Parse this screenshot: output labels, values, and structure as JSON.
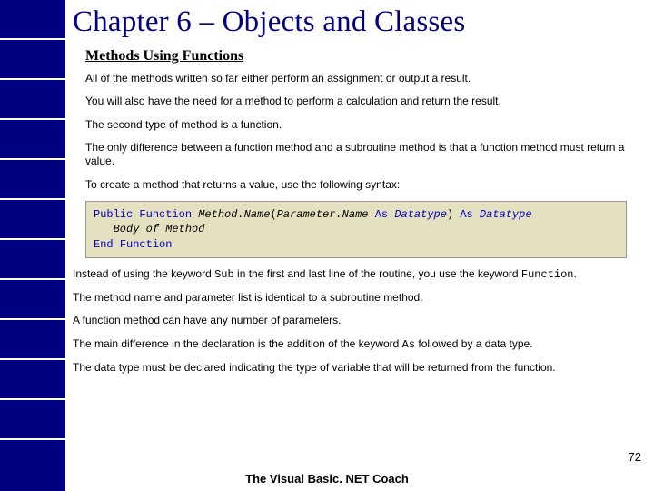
{
  "title": "Chapter 6 – Objects and Classes",
  "subtitle": "Methods Using Functions",
  "paragraphs": {
    "p1": "All of the methods written so far either perform an assignment or output a result.",
    "p2": "You will also have the need for a method to perform a calculation and return the result.",
    "p3": "The second type of method is a function.",
    "p4": "The only difference between a function method and a subroutine method is that a function method must return a value.",
    "p5": "To create a method that returns a value, use the following syntax:",
    "p6a": "Instead of using the keyword ",
    "p6b": " in the first and last line of the routine, you use the keyword ",
    "p6c": ".",
    "p7": "The method name and parameter list is identical to a subroutine method.",
    "p8": "A function method can have any number of parameters.",
    "p9a": "The main difference in the declaration is the addition of the keyword ",
    "p9b": " followed by a data type.",
    "p10": "The data type must be declared indicating the type of variable that will be returned from the function."
  },
  "code": {
    "kw_public": "Public",
    "kw_function": "Function",
    "method_name": "Method.Name",
    "paren_open": "(",
    "param_name": "Parameter.Name",
    "kw_as1": "As",
    "datatype1": "Datatype",
    "paren_close": ")",
    "kw_as2": "As",
    "datatype2": "Datatype",
    "body": "Body of Method",
    "kw_end": "End",
    "kw_function2": "Function"
  },
  "inline": {
    "sub": "Sub",
    "function": "Function",
    "as": "As"
  },
  "page_number": "72",
  "footer": "The Visual Basic. NET Coach"
}
